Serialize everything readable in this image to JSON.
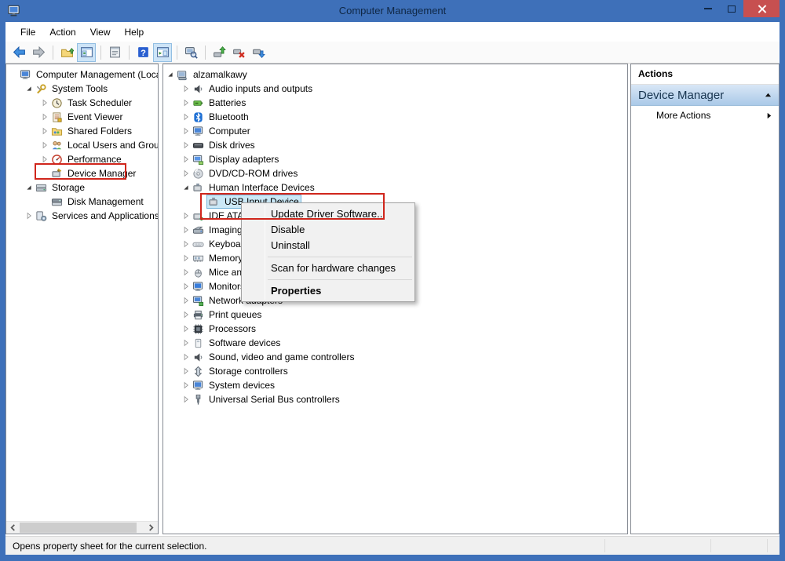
{
  "window": {
    "title": "Computer Management"
  },
  "menu_bar": {
    "items": [
      {
        "label": "File"
      },
      {
        "label": "Action"
      },
      {
        "label": "View"
      },
      {
        "label": "Help"
      }
    ]
  },
  "toolbar": {
    "buttons": [
      {
        "name": "back-button",
        "icon": "back-arrow-icon"
      },
      {
        "name": "forward-button",
        "icon": "forward-arrow-icon",
        "disabled": true
      },
      {
        "type": "separator"
      },
      {
        "name": "export-list-button",
        "icon": "folder-up-icon"
      },
      {
        "name": "console-tree-toggle-button",
        "icon": "console-tree-toggle-icon",
        "pressed": true
      },
      {
        "type": "separator"
      },
      {
        "name": "properties-button",
        "icon": "properties-icon"
      },
      {
        "type": "separator"
      },
      {
        "name": "help-button",
        "icon": "help-icon"
      },
      {
        "name": "action-pane-toggle-button",
        "icon": "action-pane-toggle-icon",
        "pressed": true
      },
      {
        "type": "separator"
      },
      {
        "name": "scan-computer-button",
        "icon": "scan-computer-icon"
      },
      {
        "type": "separator"
      },
      {
        "name": "update-driver-button",
        "icon": "update-driver-icon"
      },
      {
        "name": "uninstall-device-button",
        "icon": "uninstall-device-icon"
      },
      {
        "name": "disable-device-button",
        "icon": "disable-device-icon"
      }
    ]
  },
  "left_tree": {
    "items": [
      {
        "label": "Computer Management (Local",
        "icon": "computer-management-icon",
        "level": 0,
        "expander": "none"
      },
      {
        "label": "System Tools",
        "icon": "system-tools-icon",
        "level": 1,
        "expander": "expanded"
      },
      {
        "label": "Task Scheduler",
        "icon": "task-scheduler-icon",
        "level": 2,
        "expander": "collapsed"
      },
      {
        "label": "Event Viewer",
        "icon": "event-viewer-icon",
        "level": 2,
        "expander": "collapsed"
      },
      {
        "label": "Shared Folders",
        "icon": "shared-folders-icon",
        "level": 2,
        "expander": "collapsed"
      },
      {
        "label": "Local Users and Groups",
        "icon": "users-icon",
        "level": 2,
        "expander": "collapsed"
      },
      {
        "label": "Performance",
        "icon": "performance-icon",
        "level": 2,
        "expander": "collapsed"
      },
      {
        "label": "Device Manager",
        "icon": "device-manager-icon",
        "level": 2,
        "expander": "none"
      },
      {
        "label": "Storage",
        "icon": "storage-icon",
        "level": 1,
        "expander": "expanded"
      },
      {
        "label": "Disk Management",
        "icon": "disk-management-icon",
        "level": 2,
        "expander": "none"
      },
      {
        "label": "Services and Applications",
        "icon": "services-icon",
        "level": 1,
        "expander": "collapsed"
      }
    ]
  },
  "device_tree": {
    "items": [
      {
        "label": "alzamalkawy",
        "icon": "computer-icon",
        "level": 0,
        "expander": "expanded"
      },
      {
        "label": "Audio inputs and outputs",
        "icon": "audio-icon",
        "level": 1,
        "expander": "collapsed"
      },
      {
        "label": "Batteries",
        "icon": "battery-icon",
        "level": 1,
        "expander": "collapsed"
      },
      {
        "label": "Bluetooth",
        "icon": "bluetooth-icon",
        "level": 1,
        "expander": "collapsed"
      },
      {
        "label": "Computer",
        "icon": "computer-node-icon",
        "level": 1,
        "expander": "collapsed"
      },
      {
        "label": "Disk drives",
        "icon": "disk-drive-icon",
        "level": 1,
        "expander": "collapsed"
      },
      {
        "label": "Display adapters",
        "icon": "display-adapter-icon",
        "level": 1,
        "expander": "collapsed"
      },
      {
        "label": "DVD/CD-ROM drives",
        "icon": "dvd-icon",
        "level": 1,
        "expander": "collapsed"
      },
      {
        "label": "Human Interface Devices",
        "icon": "hid-icon",
        "level": 1,
        "expander": "expanded"
      },
      {
        "label": "USB Input Device",
        "icon": "usb-input-device-icon",
        "level": 2,
        "expander": "none",
        "selected": true
      },
      {
        "label": "IDE ATA/ATAPI controllers",
        "icon": "ide-icon",
        "level": 1,
        "expander": "collapsed"
      },
      {
        "label": "Imaging devices",
        "icon": "imaging-icon",
        "level": 1,
        "expander": "collapsed"
      },
      {
        "label": "Keyboards",
        "icon": "keyboard-icon",
        "level": 1,
        "expander": "collapsed"
      },
      {
        "label": "Memory technology devices",
        "icon": "memory-icon",
        "level": 1,
        "expander": "collapsed"
      },
      {
        "label": "Mice and other pointing devices",
        "icon": "mouse-icon",
        "level": 1,
        "expander": "collapsed"
      },
      {
        "label": "Monitors",
        "icon": "monitor-icon",
        "level": 1,
        "expander": "collapsed"
      },
      {
        "label": "Network adapters",
        "icon": "network-icon",
        "level": 1,
        "expander": "collapsed"
      },
      {
        "label": "Print queues",
        "icon": "printer-icon",
        "level": 1,
        "expander": "collapsed"
      },
      {
        "label": "Processors",
        "icon": "processor-icon",
        "level": 1,
        "expander": "collapsed"
      },
      {
        "label": "Software devices",
        "icon": "software-icon",
        "level": 1,
        "expander": "collapsed"
      },
      {
        "label": "Sound, video and game controllers",
        "icon": "sound-icon",
        "level": 1,
        "expander": "collapsed"
      },
      {
        "label": "Storage controllers",
        "icon": "storage-controller-icon",
        "level": 1,
        "expander": "collapsed"
      },
      {
        "label": "System devices",
        "icon": "system-devices-icon",
        "level": 1,
        "expander": "collapsed"
      },
      {
        "label": "Universal Serial Bus controllers",
        "icon": "usb-controller-icon",
        "level": 1,
        "expander": "collapsed"
      }
    ]
  },
  "context_menu": {
    "items": [
      {
        "label": "Update Driver Software..."
      },
      {
        "label": "Disable"
      },
      {
        "label": "Uninstall"
      },
      {
        "type": "separator"
      },
      {
        "label": "Scan for hardware changes"
      },
      {
        "type": "separator"
      },
      {
        "label": "Properties",
        "bold": true
      }
    ]
  },
  "actions_pane": {
    "title": "Actions",
    "section_header": "Device Manager",
    "more_actions_label": "More Actions"
  },
  "status_bar": {
    "text": "Opens property sheet for the current selection."
  },
  "colors": {
    "title_bar": "#3e70b9",
    "close_button": "#c75050",
    "selection_bg": "#cbe8f6",
    "annotation_red": "#d0261c",
    "actions_header_top": "#d9e7f6",
    "actions_header_bottom": "#aac9e8"
  }
}
